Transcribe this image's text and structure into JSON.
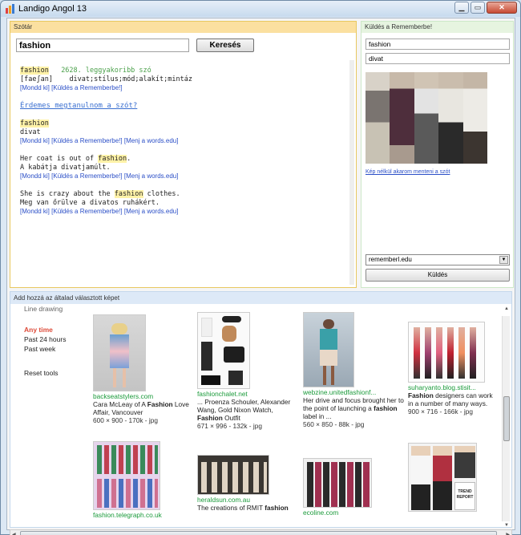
{
  "window": {
    "title": "Landigo Angol 13"
  },
  "dictionary": {
    "panel_title": "Szótár",
    "search_value": "fashion",
    "search_button": "Keresés",
    "entry_word": "fashion",
    "entry_rank": "2628. leggyakoribb szó",
    "entry_phonetic": "[faeʃan]",
    "entry_meanings": "divat;stílus;mód;alakít;mintáz",
    "link_say": "[Mondd ki]",
    "link_send": "[Küldés a Rememberbe!]",
    "link_words": "[Menj a words.edu]",
    "ask_learn": "Érdemes megtanulnom a szót?",
    "pair1_en": "fashion",
    "pair1_hu": "divat",
    "ex1_en_pre": "Her coat is out of ",
    "ex1_en_hl": "fashion",
    "ex1_en_post": ".",
    "ex1_hu": "A kabátja divatjamúlt.",
    "ex2_en_pre": "She is crazy about the ",
    "ex2_en_hl": "fashion",
    "ex2_en_post": " clothes.",
    "ex2_hu": "Meg van őrülve a divatos ruhákért."
  },
  "remember": {
    "panel_title": "Küldés a Rememberbe!",
    "word_value": "fashion",
    "meaning_value": "divat",
    "no_picture_link": "Kép nélkül akarom menteni a szót",
    "target_select": "rememberl.edu",
    "send_button": "Küldés"
  },
  "images": {
    "panel_title": "Add hozzá az általad választott képet",
    "sidebar": {
      "line_drawing": "Line drawing",
      "any_time": "Any time",
      "past_24": "Past 24 hours",
      "past_week": "Past week",
      "reset": "Reset tools"
    },
    "results": [
      {
        "source": "backseatstylers.com",
        "caption_pre": "Cara McLeay of A ",
        "caption_bold": "Fashion",
        "caption_post": " Love Affair, Vancouver",
        "meta": "600 × 900 - 170k - jpg"
      },
      {
        "source": "fashionchalet.net",
        "caption_pre": "... Proenza Schouler, Alexander Wang, Gold Nixon Watch, ",
        "caption_bold": "Fashion",
        "caption_post": " Outfit",
        "meta": "671 × 996 - 132k - jpg"
      },
      {
        "source": "webzine.unitedfashionf...",
        "caption_pre": "Her drive and focus brought her to the point of launching a ",
        "caption_bold": "fashion",
        "caption_post": " label in ...",
        "meta": "560 × 850 - 88k - jpg"
      },
      {
        "source": "suharyanto.blog.stisit...",
        "caption_pre": "",
        "caption_bold": "Fashion",
        "caption_post": " designers can work in a number of many ways.",
        "meta": "900 × 716 - 166k - jpg"
      },
      {
        "source": "fashion.telegraph.co.uk",
        "caption_pre": "",
        "caption_bold": "",
        "caption_post": "",
        "meta": ""
      },
      {
        "source": "heraldsun.com.au",
        "caption_pre": "The creations of RMIT ",
        "caption_bold": "fashion",
        "caption_post": "",
        "meta": ""
      },
      {
        "source": "ecoline.com",
        "caption_pre": "",
        "caption_bold": "",
        "caption_post": "",
        "meta": ""
      },
      {
        "source": "",
        "caption_pre": "",
        "caption_bold": "",
        "caption_post": "",
        "meta": "",
        "thumb_text": "TREND REPORT"
      }
    ]
  },
  "colors": {
    "dict_border": "#e8c860",
    "link_blue": "#2b4fc7",
    "highlight": "#fff2a8",
    "source_green": "#1a9a3a",
    "any_time_red": "#dd4b39"
  }
}
